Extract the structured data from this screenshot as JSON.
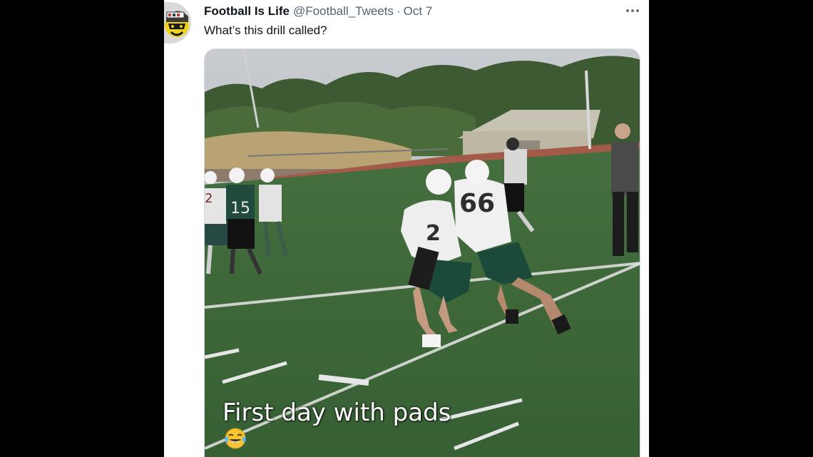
{
  "tweet": {
    "author_name": "Football Is Life",
    "handle": "@Football_Tweets",
    "separator": "·",
    "date": "Oct 7",
    "text": "What’s this drill called?",
    "more_icon": "more-horizontal-icon"
  },
  "media": {
    "caption": "First day with pads",
    "caption_emoji": "laughing-crying-emoji",
    "jersey_numbers": [
      "66",
      "2",
      "15",
      "2"
    ]
  },
  "colors": {
    "background": "#000000",
    "card": "#ffffff",
    "text_primary": "#0f1419",
    "text_secondary": "#536471",
    "field_green": "#3f6a3c",
    "team_green": "#1f4a3c"
  }
}
